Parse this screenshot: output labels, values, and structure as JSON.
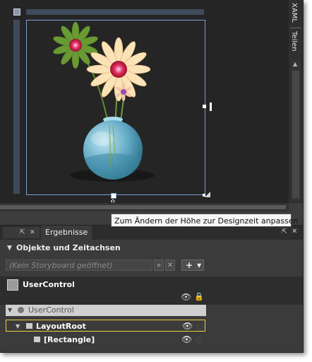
{
  "artboard": {
    "background": "#252525",
    "selection_color": "#7f9fd4"
  },
  "side_tabs": {
    "xaml_label": "XAML",
    "teilen_label": "Teilen"
  },
  "tooltip": {
    "text": "Zum Ändern der Höhe zur Designzeit anpassen"
  },
  "results_panel": {
    "tab_label": "Ergebnisse",
    "pin_icon": "pin-icon",
    "close_icon": "close-icon"
  },
  "objects_section": {
    "header": "Objekte und Zeitachsen",
    "storyboard_placeholder": "(Kein Storyboard geöffnet)",
    "add_label": "+",
    "root_name": "UserControl"
  },
  "tree": {
    "items": [
      {
        "label": "UserControl"
      },
      {
        "label": "LayoutRoot"
      },
      {
        "label": "[Rectangle]"
      }
    ]
  }
}
